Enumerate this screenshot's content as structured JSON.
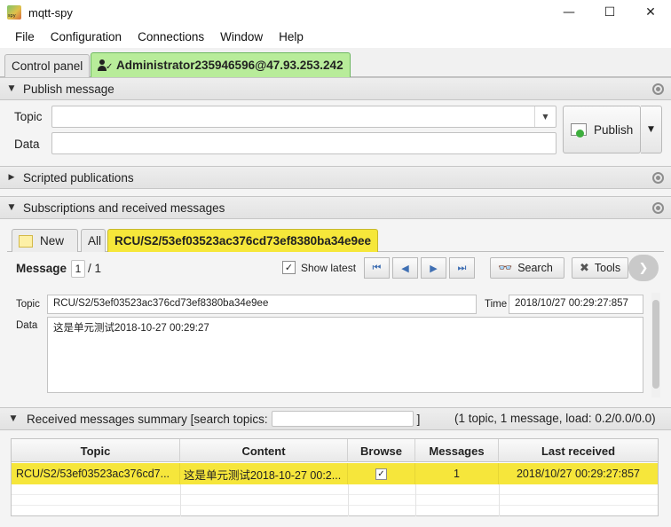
{
  "window": {
    "title": "mqtt-spy",
    "minimize": "—",
    "maximize": "☐",
    "close": "✕"
  },
  "menu": [
    "File",
    "Configuration",
    "Connections",
    "Window",
    "Help"
  ],
  "tabs": {
    "control_panel": "Control panel",
    "connection": "Administrator235946596@47.93.253.242"
  },
  "publish": {
    "header": "Publish message",
    "topic_label": "Topic",
    "topic_value": "",
    "data_label": "Data",
    "data_value": "",
    "publish_label": "Publish"
  },
  "scripted": {
    "header": "Scripted publications"
  },
  "subscriptions": {
    "header": "Subscriptions and received messages",
    "tabs": {
      "new": "New",
      "all": "All",
      "active": "RCU/S2/53ef03523ac376cd73ef8380ba34e9ee"
    },
    "message_label": "Message",
    "message_index": "1",
    "message_total": "/ 1",
    "show_latest": "Show latest",
    "search_label": "Search",
    "tools_label": "Tools",
    "topic_label": "Topic",
    "topic_value": "RCU/S2/53ef03523ac376cd73ef8380ba34e9ee",
    "time_label": "Time",
    "time_value": "2018/10/27 00:29:27:857",
    "data_label": "Data",
    "data_value": "这是单元测试2018-10-27 00:29:27"
  },
  "summary": {
    "header": "Received messages summary [search topics:",
    "header_close": "]",
    "search_value": "",
    "stats": "(1 topic, 1 message, load: 0.2/0.0/0.0)",
    "columns": [
      "Topic",
      "Content",
      "Browse",
      "Messages",
      "Last received"
    ],
    "rows": [
      {
        "topic": "RCU/S2/53ef03523ac376cd7...",
        "content": "这是单元测试2018-10-27 00:2...",
        "browse": "✓",
        "messages": "1",
        "last_received": "2018/10/27 00:29:27:857"
      }
    ]
  }
}
